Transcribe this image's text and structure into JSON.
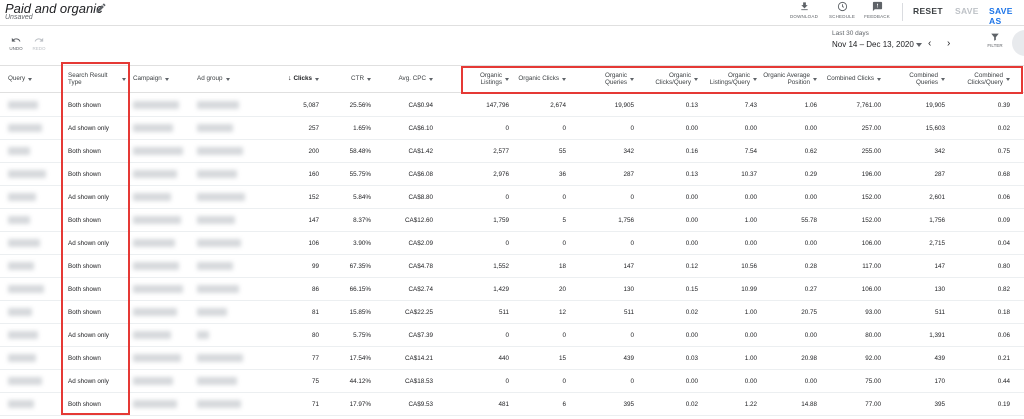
{
  "header": {
    "title": "Paid and organic",
    "subtitle": "Unsaved",
    "toolbar": [
      {
        "id": "download",
        "label": "DOWNLOAD"
      },
      {
        "id": "schedule",
        "label": "SCHEDULE"
      },
      {
        "id": "feedback",
        "label": "FEEDBACK"
      }
    ],
    "reset_label": "RESET",
    "save_label": "SAVE",
    "save_as_label": "SAVE AS"
  },
  "toolbar2": {
    "undo_label": "UNDO",
    "redo_label": "REDO",
    "date_range_label": "Last 30 days",
    "date_range_value": "Nov 14 – Dec 13, 2020",
    "filter_label": "FILTER"
  },
  "table": {
    "columns": [
      {
        "key": "query",
        "label": "Query"
      },
      {
        "key": "type",
        "label": "Search Result Type"
      },
      {
        "key": "campaign",
        "label": "Campaign"
      },
      {
        "key": "adgroup",
        "label": "Ad group"
      },
      {
        "key": "clicks",
        "label": "Clicks"
      },
      {
        "key": "ctr",
        "label": "CTR"
      },
      {
        "key": "cpc",
        "label": "Avg. CPC"
      },
      {
        "key": "org_listings",
        "label": "Organic Listings"
      },
      {
        "key": "org_clicks",
        "label": "Organic Clicks"
      },
      {
        "key": "org_queries",
        "label": "Organic Queries"
      },
      {
        "key": "org_cq",
        "label": "Organic Clicks/Query"
      },
      {
        "key": "org_lq",
        "label": "Organic Listings/Query"
      },
      {
        "key": "org_pos",
        "label": "Organic Average Position"
      },
      {
        "key": "comb_clicks",
        "label": "Combined Clicks"
      },
      {
        "key": "comb_queries",
        "label": "Combined Queries"
      },
      {
        "key": "comb_cq",
        "label": "Combined Clicks/Query"
      }
    ],
    "rows": [
      [
        "Both shown",
        "5,087",
        "25.56%",
        "CA$0.94",
        "147,796",
        "2,674",
        "19,905",
        "0.13",
        "7.43",
        "1.06",
        "7,761.00",
        "19,905",
        "0.39"
      ],
      [
        "Ad shown only",
        "257",
        "1.65%",
        "CA$6.10",
        "0",
        "0",
        "0",
        "0.00",
        "0.00",
        "0.00",
        "257.00",
        "15,603",
        "0.02"
      ],
      [
        "Both shown",
        "200",
        "58.48%",
        "CA$1.42",
        "2,577",
        "55",
        "342",
        "0.16",
        "7.54",
        "0.62",
        "255.00",
        "342",
        "0.75"
      ],
      [
        "Both shown",
        "160",
        "55.75%",
        "CA$6.08",
        "2,976",
        "36",
        "287",
        "0.13",
        "10.37",
        "0.29",
        "196.00",
        "287",
        "0.68"
      ],
      [
        "Ad shown only",
        "152",
        "5.84%",
        "CA$8.80",
        "0",
        "0",
        "0",
        "0.00",
        "0.00",
        "0.00",
        "152.00",
        "2,601",
        "0.06"
      ],
      [
        "Both shown",
        "147",
        "8.37%",
        "CA$12.60",
        "1,759",
        "5",
        "1,756",
        "0.00",
        "1.00",
        "55.78",
        "152.00",
        "1,756",
        "0.09"
      ],
      [
        "Ad shown only",
        "106",
        "3.90%",
        "CA$2.09",
        "0",
        "0",
        "0",
        "0.00",
        "0.00",
        "0.00",
        "106.00",
        "2,715",
        "0.04"
      ],
      [
        "Both shown",
        "99",
        "67.35%",
        "CA$4.78",
        "1,552",
        "18",
        "147",
        "0.12",
        "10.56",
        "0.28",
        "117.00",
        "147",
        "0.80"
      ],
      [
        "Both shown",
        "86",
        "66.15%",
        "CA$2.74",
        "1,429",
        "20",
        "130",
        "0.15",
        "10.99",
        "0.27",
        "106.00",
        "130",
        "0.82"
      ],
      [
        "Both shown",
        "81",
        "15.85%",
        "CA$22.25",
        "511",
        "12",
        "511",
        "0.02",
        "1.00",
        "20.75",
        "93.00",
        "511",
        "0.18"
      ],
      [
        "Ad shown only",
        "80",
        "5.75%",
        "CA$7.39",
        "0",
        "0",
        "0",
        "0.00",
        "0.00",
        "0.00",
        "80.00",
        "1,391",
        "0.06"
      ],
      [
        "Both shown",
        "77",
        "17.54%",
        "CA$14.21",
        "440",
        "15",
        "439",
        "0.03",
        "1.00",
        "20.98",
        "92.00",
        "439",
        "0.21"
      ],
      [
        "Ad shown only",
        "75",
        "44.12%",
        "CA$18.53",
        "0",
        "0",
        "0",
        "0.00",
        "0.00",
        "0.00",
        "75.00",
        "170",
        "0.44"
      ],
      [
        "Both shown",
        "71",
        "17.97%",
        "CA$9.53",
        "481",
        "6",
        "395",
        "0.02",
        "1.22",
        "14.88",
        "77.00",
        "395",
        "0.19"
      ]
    ]
  },
  "colors": {
    "highlight": "#e53935",
    "accent": "#1a73e8"
  }
}
